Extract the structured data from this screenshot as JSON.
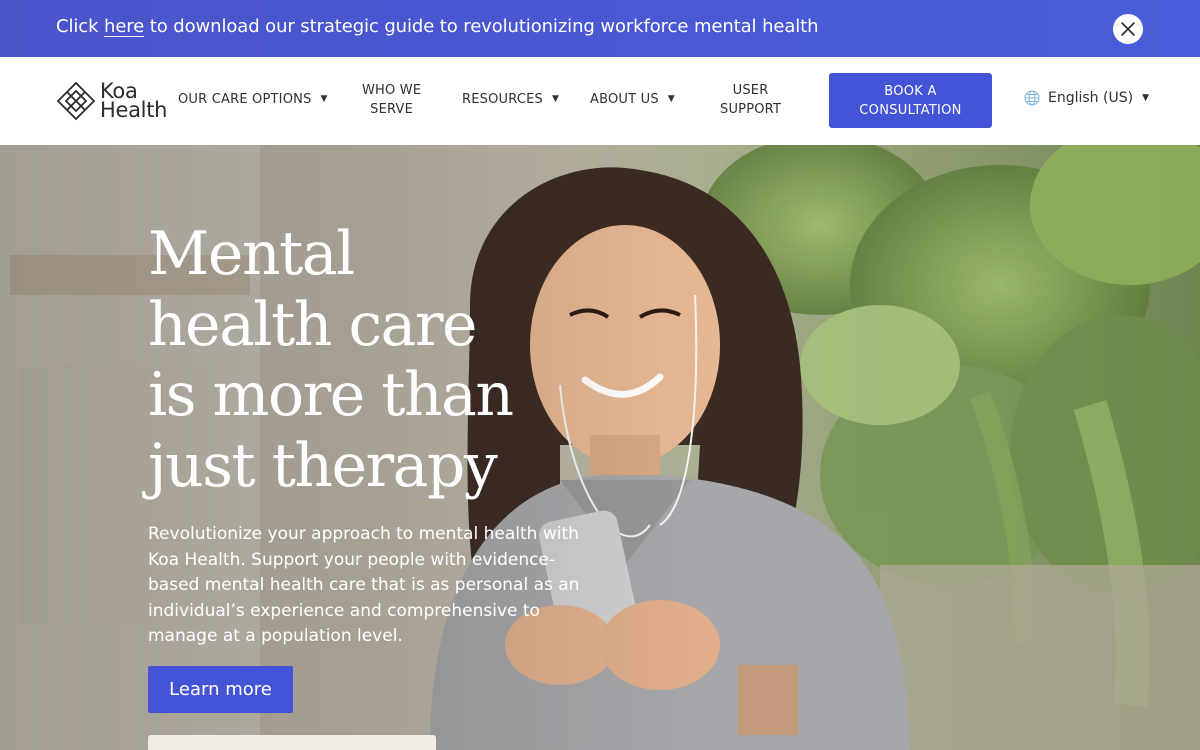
{
  "banner": {
    "prefix": "Click ",
    "link": "here",
    "suffix": " to download our strategic guide to revolutionizing workforce mental health"
  },
  "header": {
    "logo": {
      "line1": "Koa",
      "line2": "Health"
    },
    "nav": {
      "care_options": "OUR CARE OPTIONS",
      "who_we_serve_1": "WHO WE",
      "who_we_serve_2": "SERVE",
      "resources": "RESOURCES",
      "about_us": "ABOUT US",
      "user_support_1": "USER",
      "user_support_2": "SUPPORT"
    },
    "book": {
      "line1": "BOOK A",
      "line2": "CONSULTATION"
    },
    "language": "English (US)"
  },
  "hero": {
    "title_lines": [
      "Mental",
      "health care",
      "is more than",
      "just therapy"
    ],
    "description": "Revolutionize your approach to mental health with Koa Health. Support your people with evidence-based mental health care that is as personal as an individual’s experience and comprehensive to manage at a population level.",
    "cta": "Learn more"
  },
  "colors": {
    "brand_blue": "#4553d6",
    "banner_blue": "#4b54c9"
  }
}
